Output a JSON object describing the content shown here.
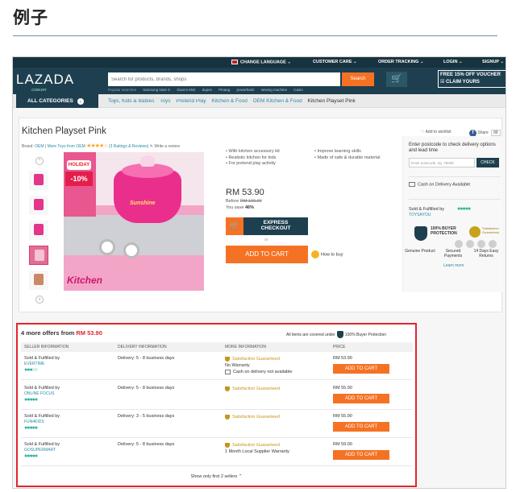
{
  "doc": {
    "heading": "例子"
  },
  "topbar": {
    "change_language": "CHANGE LANGUAGE ⌄",
    "customer_care": "CUSTOMER CARE ⌄",
    "order_tracking": "ORDER TRACKING ⌄",
    "login": "LOGIN ⌄",
    "signup": "SIGNUP ⌄"
  },
  "header": {
    "logo": "LAZADA",
    "logo_sub": ".COM.MY",
    "search_placeholder": "Search for products, brands, shops",
    "search_button": "Search",
    "voucher_line1": "FREE 15% OFF VOUCHER",
    "voucher_line2": "☒ CLAIM YOURS",
    "popular_label": "Popular searches",
    "popular": [
      "Samsung Note 5",
      "Xiaomi Mi4i",
      "dupes",
      "Pinang",
      "powerbank",
      "sewing machine",
      "Casio"
    ]
  },
  "nav": {
    "all_categories": "ALL CATEGORIES",
    "breadcrumbs": [
      "Toys, Kids & Babies",
      "Toys",
      "Pretend Play",
      "Kitchen & Food",
      "OEM Kitchen & Food"
    ],
    "current": "Kitchen Playset Pink",
    "separator": "›"
  },
  "product": {
    "title": "Kitchen Playset Pink",
    "brand_label": "Brand:",
    "brand": "OEM",
    "more_toys": "More Toys from OEM",
    "stars": "★★★★☆",
    "ratings": "(3 Ratings & Reviews)",
    "write_review": "✎ Write a review",
    "wishlist": "♡ Add to wishlist",
    "share_label": "Share",
    "share_icon": "f",
    "share_count": "88",
    "features_left": [
      "• With kitchen accessory kit",
      "• Realistic kitchen for kids",
      "• For pretend play activity"
    ],
    "features_right": [
      "• Improve learning skills",
      "• Made of safe & durable material"
    ],
    "price": "RM 53.90",
    "before_label": "Before",
    "before_price": "RM 100.00",
    "save_label": "You save",
    "save_pct": "46%",
    "express_line1": "EXPRESS",
    "express_line2": "CHECKOUT",
    "or": "or",
    "add_to_cart": "ADD TO CART",
    "how_to_buy": "How to buy",
    "image_badge_logo": "HOLIDAY",
    "image_badge_pct": "-10%",
    "image_pot_label": "Sunshine",
    "image_kitchen_text": "Kitchen",
    "thumb_up": "^",
    "thumb_down": "v"
  },
  "sidebox": {
    "postcode_label": "Enter postcode to check delivery options and lead time",
    "postcode_placeholder": "Enter postcode, eg. 75000",
    "check": "CHECK",
    "cod": "Cash on Delivery Available",
    "sold_by": "Sold & Fulfilled by",
    "rating_dots": "●●●●●",
    "seller_name": "TOYSAYOU",
    "protection": "100% BUYER PROTECTION",
    "satisfaction": "Satisfaction Guaranteed",
    "guarantees": [
      "Genuine Product",
      "Secured Payments",
      "14 Days Easy Returns"
    ],
    "learn_more": "Learn more"
  },
  "offers": {
    "title_prefix": "4 more offers from",
    "title_price": "RM 53.90",
    "covered": "All items are covered under",
    "covered_suffix": "100% Buyer Protection",
    "columns": [
      "SELLER INFORMATION",
      "DELIVERY INFORMATION",
      "MORE INFORMATION",
      "PRICE"
    ],
    "rows": [
      {
        "sold": "Sold & Fulfilled by",
        "seller": "EVERTIME",
        "rating": "●●●○○",
        "delivery": "Delivery: 5 - 8 business days",
        "sat": "Satisfaction Guaranteed",
        "info1": "No Warranty",
        "info2": "Cash on delivery not available",
        "price": "RM 53.90",
        "btn": "ADD TO CART"
      },
      {
        "sold": "Sold & Fulfilled by",
        "seller": "ONLINE FOCUS",
        "rating": "●●●●●",
        "delivery": "Delivery: 5 - 8 business days",
        "sat": "Satisfaction Guaranteed",
        "info1": "",
        "info2": "",
        "price": "RM 55.90",
        "btn": "ADD TO CART"
      },
      {
        "sold": "Sold & Fulfilled by",
        "seller": "FUN4KIDS",
        "rating": "●●●●●",
        "delivery": "Delivery: 3 - 5 business days",
        "sat": "Satisfaction Guaranteed",
        "info1": "",
        "info2": "",
        "price": "RM 55.90",
        "btn": "ADD TO CART"
      },
      {
        "sold": "Sold & Fulfilled by",
        "seller": "GOSUPERMART",
        "rating": "●●●●●",
        "delivery": "Delivery: 5 - 8 business days",
        "sat": "Satisfaction Guaranteed",
        "info1": "1 Month Local Supplier Warranty",
        "info2": "",
        "price": "RM 59.00",
        "btn": "ADD TO CART"
      }
    ],
    "show_only": "Show only first 2 sellers ⌃"
  },
  "colors": {
    "brand_dark": "#1e3f4f",
    "accent_orange": "#f57224",
    "highlight_red": "#e0262f",
    "link": "#2a8aa8"
  }
}
